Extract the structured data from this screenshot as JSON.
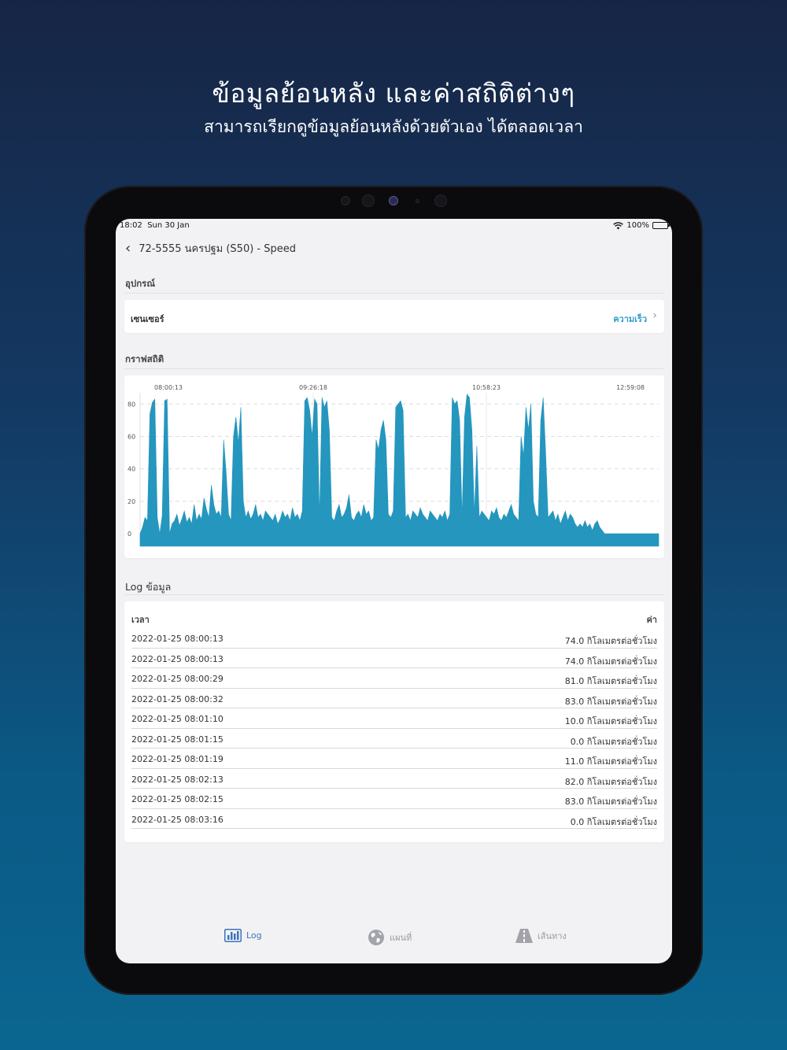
{
  "promo": {
    "title": "ข้อมูลย้อนหลัง และค่าสถิติต่างๆ",
    "subtitle": "สามารถเรียกดูข้อมูลย้อนหลังด้วยตัวเอง ได้ตลอดเวลา"
  },
  "status_bar": {
    "time": "18:02",
    "date": "Sun 30 Jan",
    "battery": "100%"
  },
  "nav": {
    "title": "72-5555 นครปฐม (S50) - Speed",
    "back_icon": "chevron-left-icon"
  },
  "device_section": {
    "label": "อุปกรณ์",
    "sensor_label": "เซนเซอร์",
    "sensor_value": "ความเร็ว"
  },
  "graph_section": {
    "label": "กราฟสถิติ"
  },
  "colors": {
    "chart_fill": "#2596be",
    "accent": "#2f9bc9",
    "tab_active": "#3b74b9"
  },
  "chart_data": {
    "type": "area",
    "x_ticks": [
      "08:00:13",
      "09:26:18",
      "10:58:23",
      "12:59:08"
    ],
    "y_ticks": [
      0,
      20,
      40,
      60,
      80
    ],
    "ylim": [
      0,
      85
    ],
    "grid": true,
    "series": [
      {
        "values": [
          0,
          4,
          10,
          8,
          74,
          81,
          83,
          10,
          0,
          11,
          82,
          83,
          0,
          6,
          8,
          12,
          5,
          9,
          14,
          7,
          10,
          6,
          18,
          8,
          12,
          9,
          22,
          15,
          10,
          30,
          18,
          12,
          14,
          10,
          58,
          38,
          12,
          8,
          60,
          72,
          56,
          78,
          20,
          10,
          14,
          9,
          12,
          18,
          10,
          12,
          8,
          14,
          12,
          10,
          8,
          12,
          6,
          9,
          14,
          10,
          12,
          8,
          16,
          10,
          12,
          8,
          14,
          82,
          84,
          76,
          60,
          83,
          80,
          10,
          84,
          78,
          82,
          64,
          10,
          8,
          14,
          18,
          10,
          12,
          16,
          24,
          10,
          8,
          12,
          14,
          10,
          18,
          12,
          14,
          8,
          10,
          58,
          52,
          64,
          70,
          58,
          12,
          10,
          14,
          78,
          80,
          82,
          76,
          10,
          12,
          8,
          14,
          12,
          10,
          16,
          12,
          10,
          8,
          14,
          12,
          10,
          8,
          12,
          10,
          14,
          8,
          12,
          84,
          80,
          82,
          70,
          10,
          72,
          86,
          84,
          64,
          12,
          54,
          10,
          14,
          12,
          10,
          8,
          14,
          12,
          16,
          10,
          8,
          12,
          10,
          14,
          18,
          12,
          10,
          8,
          60,
          48,
          78,
          64,
          80,
          20,
          12,
          10,
          70,
          84,
          50,
          10,
          12,
          14,
          8,
          12,
          6,
          10,
          14,
          8,
          12,
          10,
          6,
          4,
          6,
          4,
          8,
          4,
          6,
          2,
          6,
          8,
          4,
          2,
          0,
          0,
          0,
          0,
          0,
          0,
          0,
          0,
          0,
          0,
          0,
          0,
          0,
          0,
          0,
          0,
          0,
          0,
          0,
          0,
          0,
          0,
          0
        ]
      }
    ]
  },
  "log_section": {
    "label": "Log ข้อมูล",
    "col_time": "เวลา",
    "col_value": "ค่า",
    "rows": [
      {
        "time": "2022-01-25 08:00:13",
        "value": "74.0 กิโลเมตรต่อชั่วโมง"
      },
      {
        "time": "2022-01-25 08:00:13",
        "value": "74.0 กิโลเมตรต่อชั่วโมง"
      },
      {
        "time": "2022-01-25 08:00:29",
        "value": "81.0 กิโลเมตรต่อชั่วโมง"
      },
      {
        "time": "2022-01-25 08:00:32",
        "value": "83.0 กิโลเมตรต่อชั่วโมง"
      },
      {
        "time": "2022-01-25 08:01:10",
        "value": "10.0 กิโลเมตรต่อชั่วโมง"
      },
      {
        "time": "2022-01-25 08:01:15",
        "value": "0.0 กิโลเมตรต่อชั่วโมง"
      },
      {
        "time": "2022-01-25 08:01:19",
        "value": "11.0 กิโลเมตรต่อชั่วโมง"
      },
      {
        "time": "2022-01-25 08:02:13",
        "value": "82.0 กิโลเมตรต่อชั่วโมง"
      },
      {
        "time": "2022-01-25 08:02:15",
        "value": "83.0 กิโลเมตรต่อชั่วโมง"
      },
      {
        "time": "2022-01-25 08:03:16",
        "value": "0.0 กิโลเมตรต่อชั่วโมง"
      }
    ]
  },
  "tabbar": {
    "tabs": [
      {
        "label": "Log",
        "icon": "bar-chart-icon",
        "active": true
      },
      {
        "label": "แผนที่",
        "icon": "globe-icon",
        "active": false
      },
      {
        "label": "เส้นทาง",
        "icon": "road-icon",
        "active": false
      }
    ]
  }
}
